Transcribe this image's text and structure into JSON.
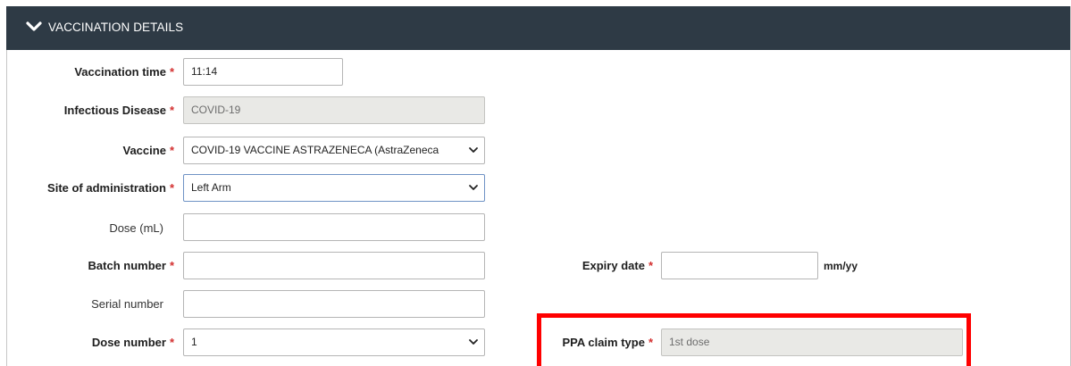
{
  "section": {
    "title": "VACCINATION DETAILS"
  },
  "required_marker": "*",
  "fields": {
    "vaccination_time": {
      "label": "Vaccination time",
      "value": "11:14"
    },
    "infectious_disease": {
      "label": "Infectious Disease",
      "value": "COVID-19"
    },
    "vaccine": {
      "label": "Vaccine",
      "value": "COVID-19 VACCINE ASTRAZENECA (AstraZeneca"
    },
    "site_of_administration": {
      "label": "Site of administration",
      "value": "Left Arm"
    },
    "dose_ml": {
      "label": "Dose (mL)",
      "value": ""
    },
    "batch_number": {
      "label": "Batch number",
      "value": ""
    },
    "serial_number": {
      "label": "Serial number",
      "value": ""
    },
    "dose_number": {
      "label": "Dose number",
      "value": "1"
    },
    "expiry_date": {
      "label": "Expiry date",
      "value": "",
      "unit": "mm/yy"
    },
    "ppa_claim_type": {
      "label": "PPA claim type",
      "value": "1st dose"
    }
  },
  "colors": {
    "header_bg": "#2e3a45",
    "required": "#d32f2f",
    "highlight": "#ff0000",
    "readonly_bg": "#e9e9e6"
  },
  "icons": {
    "section_toggle": "chevron-down-icon",
    "select_arrow": "chevron-down-icon"
  }
}
